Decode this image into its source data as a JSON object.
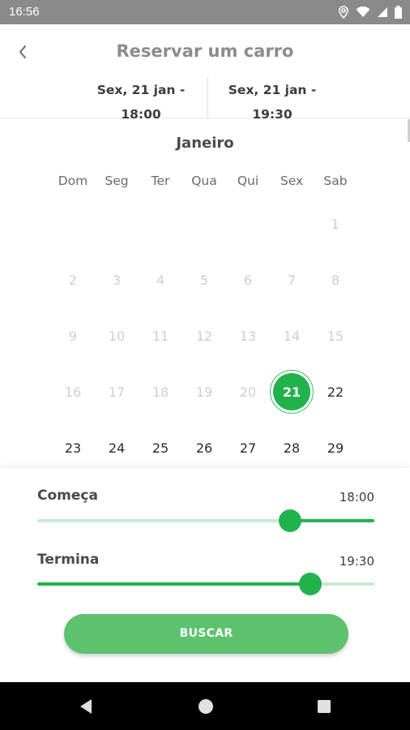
{
  "status_bar": {
    "time": "16:56",
    "icons": [
      "location-icon",
      "wifi-icon",
      "signal-icon",
      "battery-icon"
    ]
  },
  "header": {
    "title": "Reservar um carro",
    "back_icon": "chevron-left-icon"
  },
  "range": {
    "start": "Sex, 21 jan - 18:00",
    "end": "Sex, 21 jan - 19:30"
  },
  "calendar": {
    "month": "Janeiro",
    "weekdays": [
      "Dom",
      "Seg",
      "Ter",
      "Qua",
      "Qui",
      "Sex",
      "Sab"
    ],
    "weeks": [
      [
        "",
        "",
        "",
        "",
        "",
        "",
        "1"
      ],
      [
        "2",
        "3",
        "4",
        "5",
        "6",
        "7",
        "8"
      ],
      [
        "9",
        "10",
        "11",
        "12",
        "13",
        "14",
        "15"
      ],
      [
        "16",
        "17",
        "18",
        "19",
        "20",
        "21",
        "22"
      ],
      [
        "23",
        "24",
        "25",
        "26",
        "27",
        "28",
        "29"
      ]
    ],
    "selected_day": "21",
    "first_enabled_day": 21
  },
  "sliders": {
    "start": {
      "label": "Começa",
      "value": "18:00",
      "fraction": 0.75
    },
    "end": {
      "label": "Termina",
      "value": "19:30",
      "fraction": 0.81
    }
  },
  "search_button": "BUSCAR",
  "colors": {
    "accent": "#22b24c",
    "button": "#5cc26e",
    "track_light": "#c6ebd2"
  }
}
